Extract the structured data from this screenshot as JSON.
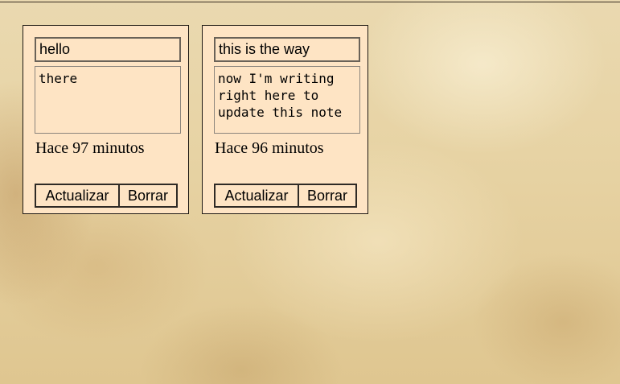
{
  "notes": [
    {
      "title": "hello",
      "body": "there",
      "time": "Hace 97 minutos",
      "update_label": "Actualizar",
      "delete_label": "Borrar"
    },
    {
      "title": "this is the way",
      "body": "now I'm writing right here to update this note",
      "time": "Hace 96 minutos",
      "update_label": "Actualizar",
      "delete_label": "Borrar"
    }
  ]
}
